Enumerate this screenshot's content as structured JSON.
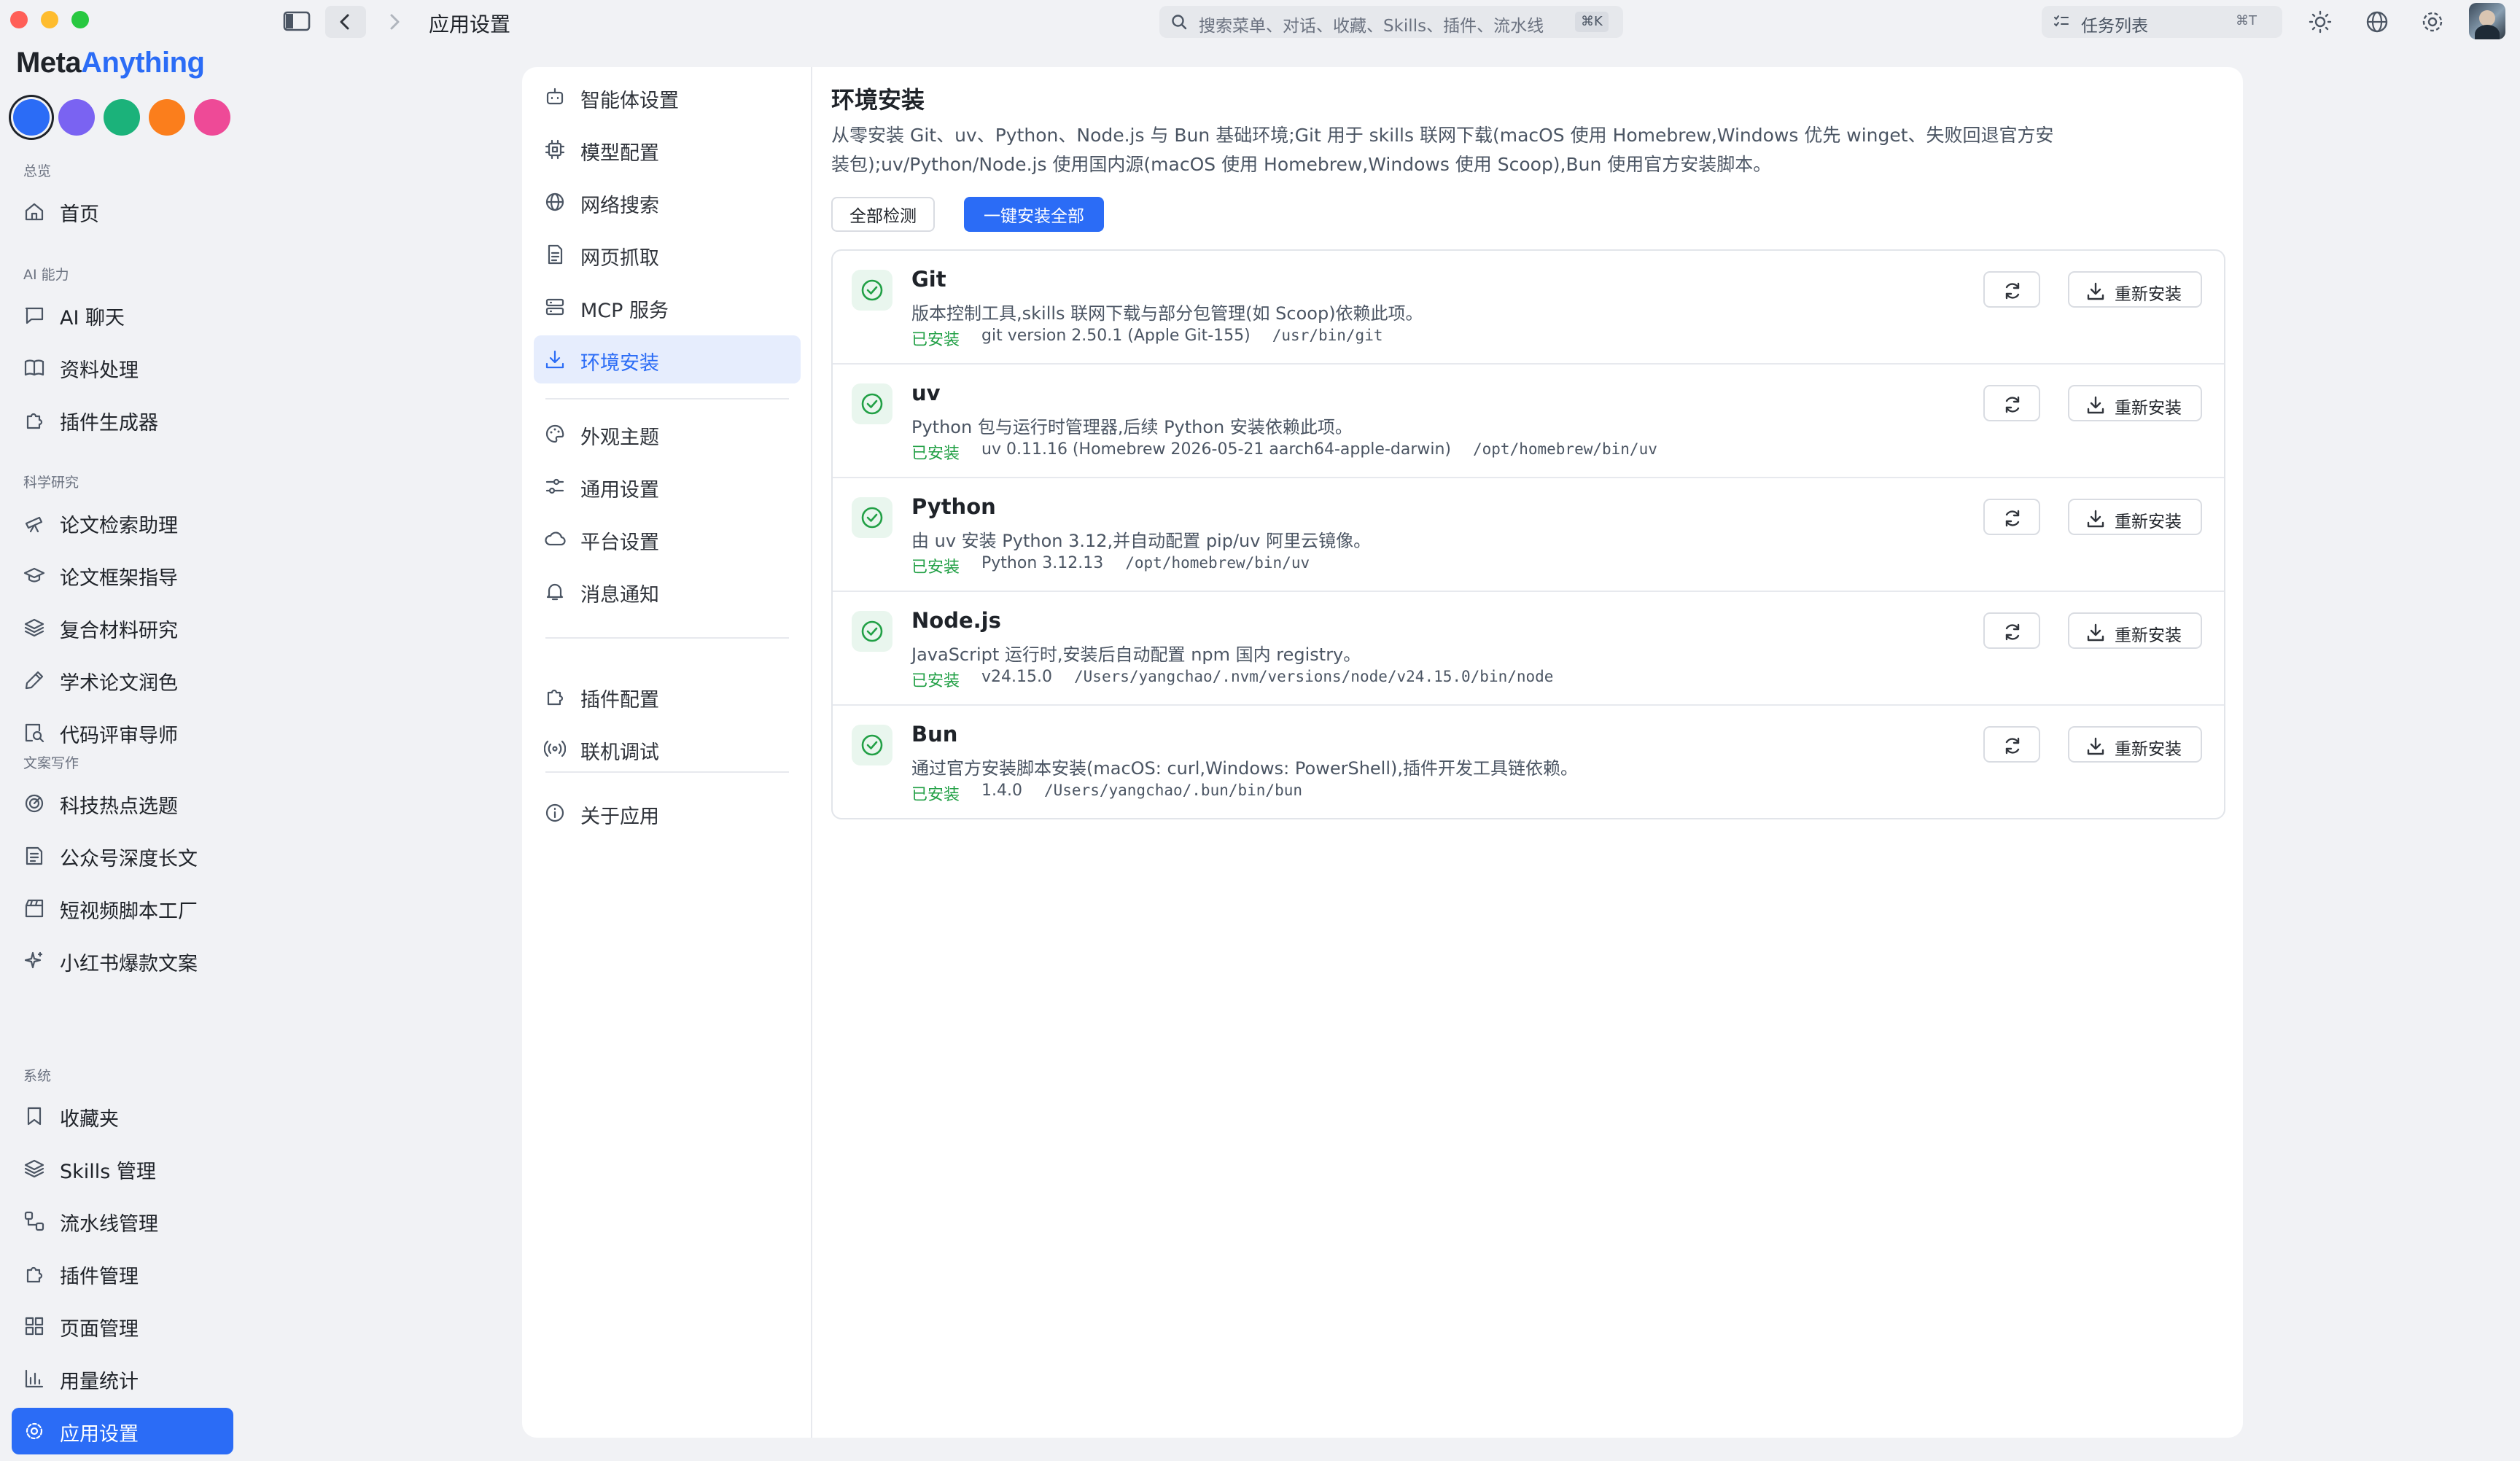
{
  "window": {
    "traffic_colors": [
      "#ff5f57",
      "#febc2e",
      "#28c840"
    ],
    "breadcrumb": "应用设置",
    "search_placeholder": "搜索菜单、对话、收藏、Skills、插件、流水线",
    "search_shortcut": "⌘K",
    "tasks_label": "任务列表",
    "tasks_shortcut": "⌘T"
  },
  "brand": {
    "part1": "Meta",
    "part2": "Anything"
  },
  "theme_swatches": [
    "#2b6cf6",
    "#7a63f2",
    "#1bb27a",
    "#fb7e1c",
    "#ee4a97"
  ],
  "sidebar": {
    "sections": [
      {
        "title": "总览",
        "items": [
          {
            "label": "首页",
            "icon": "home-icon"
          }
        ]
      },
      {
        "title": "AI 能力",
        "items": [
          {
            "label": "AI 聊天",
            "icon": "chat-icon"
          },
          {
            "label": "资料处理",
            "icon": "book-icon"
          },
          {
            "label": "插件生成器",
            "icon": "puzzle-icon"
          }
        ]
      },
      {
        "title": "科学研究",
        "items": [
          {
            "label": "论文检索助理",
            "icon": "telescope-icon"
          },
          {
            "label": "论文框架指导",
            "icon": "graduation-cap-icon"
          },
          {
            "label": "复合材料研究",
            "icon": "layers-icon"
          },
          {
            "label": "学术论文润色",
            "icon": "pen-icon"
          },
          {
            "label": "代码评审导师",
            "icon": "search-code-icon"
          }
        ]
      },
      {
        "title": "文案写作",
        "items": [
          {
            "label": "科技热点选题",
            "icon": "radar-icon"
          },
          {
            "label": "公众号深度长文",
            "icon": "article-icon"
          },
          {
            "label": "短视频脚本工厂",
            "icon": "clapperboard-icon"
          },
          {
            "label": "小红书爆款文案",
            "icon": "sparkles-icon"
          }
        ]
      },
      {
        "title": "系统",
        "items": [
          {
            "label": "收藏夹",
            "icon": "bookmark-icon"
          },
          {
            "label": "Skills 管理",
            "icon": "layers-icon"
          },
          {
            "label": "流水线管理",
            "icon": "workflow-icon"
          },
          {
            "label": "插件管理",
            "icon": "puzzle-icon"
          },
          {
            "label": "页面管理",
            "icon": "grid-icon"
          },
          {
            "label": "用量统计",
            "icon": "bar-chart-icon"
          },
          {
            "label": "应用设置",
            "icon": "gear-icon",
            "active": true
          }
        ]
      }
    ]
  },
  "settings_nav": {
    "groups": [
      [
        {
          "label": "智能体设置",
          "icon": "bot-icon"
        },
        {
          "label": "模型配置",
          "icon": "cpu-icon"
        },
        {
          "label": "网络搜索",
          "icon": "globe-icon"
        },
        {
          "label": "网页抓取",
          "icon": "file-text-icon"
        },
        {
          "label": "MCP 服务",
          "icon": "server-icon"
        },
        {
          "label": "环境安装",
          "icon": "download-icon",
          "active": true
        }
      ],
      [
        {
          "label": "外观主题",
          "icon": "palette-icon"
        },
        {
          "label": "通用设置",
          "icon": "sliders-icon"
        },
        {
          "label": "平台设置",
          "icon": "cloud-icon"
        },
        {
          "label": "消息通知",
          "icon": "bell-icon"
        }
      ],
      [
        {
          "label": "插件配置",
          "icon": "puzzle-icon"
        },
        {
          "label": "联机调试",
          "icon": "radio-icon"
        }
      ],
      [
        {
          "label": "关于应用",
          "icon": "info-icon"
        }
      ]
    ]
  },
  "env": {
    "title": "环境安装",
    "description": "从零安装 Git、uv、Python、Node.js 与 Bun 基础环境;Git 用于 skills 联网下载(macOS 使用 Homebrew,Windows 优先 winget、失败回退官方安装包);uv/Python/Node.js 使用国内源(macOS 使用 Homebrew,Windows 使用 Scoop),Bun 使用官方安装脚本。",
    "check_all_label": "全部检测",
    "install_all_label": "一键安装全部",
    "reinstall_label": "重新安装",
    "items": [
      {
        "name": "Git",
        "desc": "版本控制工具,skills 联网下载与部分包管理(如 Scoop)依赖此项。",
        "status": "已安装",
        "version": "git version 2.50.1 (Apple Git-155)",
        "path": "/usr/bin/git"
      },
      {
        "name": "uv",
        "desc": "Python 包与运行时管理器,后续 Python 安装依赖此项。",
        "status": "已安装",
        "version": "uv 0.11.16 (Homebrew 2026-05-21 aarch64-apple-darwin)",
        "path": "/opt/homebrew/bin/uv"
      },
      {
        "name": "Python",
        "desc": "由 uv 安装 Python 3.12,并自动配置 pip/uv 阿里云镜像。",
        "status": "已安装",
        "version": "Python 3.12.13",
        "path": "/opt/homebrew/bin/uv"
      },
      {
        "name": "Node.js",
        "desc": "JavaScript 运行时,安装后自动配置 npm 国内 registry。",
        "status": "已安装",
        "version": "v24.15.0",
        "path": "/Users/yangchao/.nvm/versions/node/v24.15.0/bin/node"
      },
      {
        "name": "Bun",
        "desc": "通过官方安装脚本安装(macOS: curl,Windows: PowerShell),插件开发工具链依赖。",
        "status": "已安装",
        "version": "1.4.0",
        "path": "/Users/yangchao/.bun/bin/bun"
      }
    ]
  }
}
